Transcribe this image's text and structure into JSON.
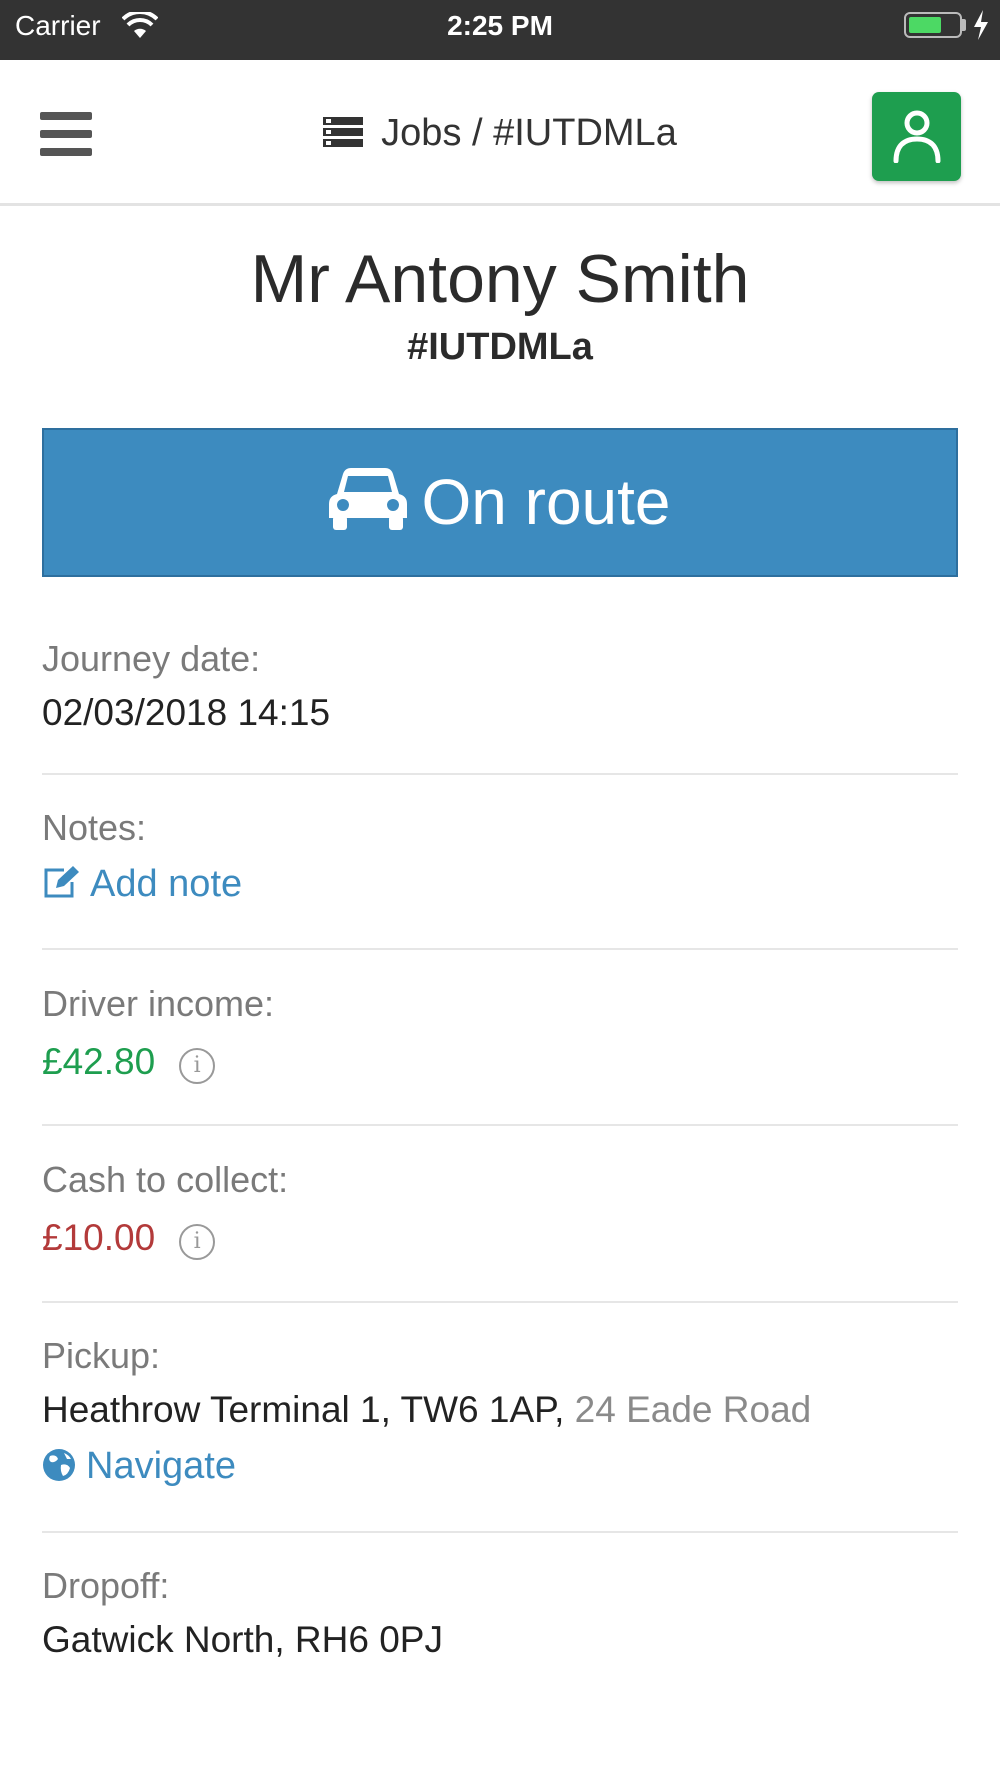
{
  "status_bar": {
    "carrier": "Carrier",
    "time": "2:25 PM"
  },
  "header": {
    "title": "Jobs / #IUTDMLa",
    "menu_icon": "hamburger-icon",
    "profile_icon": "user-icon"
  },
  "job": {
    "customer_name": "Mr Antony Smith",
    "reference": "#IUTDMLa",
    "status_label": "On route",
    "status_icon": "car-icon"
  },
  "fields": {
    "journey_date": {
      "label": "Journey date:",
      "value": "02/03/2018 14:15"
    },
    "notes": {
      "label": "Notes:",
      "link": "Add note"
    },
    "driver_income": {
      "label": "Driver income:",
      "value": "£42.80",
      "info": "i"
    },
    "cash_to_collect": {
      "label": "Cash to collect:",
      "value": "£10.00",
      "info": "i"
    },
    "pickup": {
      "label": "Pickup:",
      "value": "Heathrow Terminal 1, TW6 1AP,",
      "extra": "24 Eade Road",
      "link": "Navigate"
    },
    "dropoff": {
      "label": "Dropoff:",
      "value": "Gatwick North, RH6 0PJ"
    }
  },
  "colors": {
    "status_button": "#3d8bbf",
    "profile_button": "#1e9e4f",
    "income": "#1e9e4f",
    "cash": "#b33a3a",
    "link": "#3d8bbf"
  }
}
